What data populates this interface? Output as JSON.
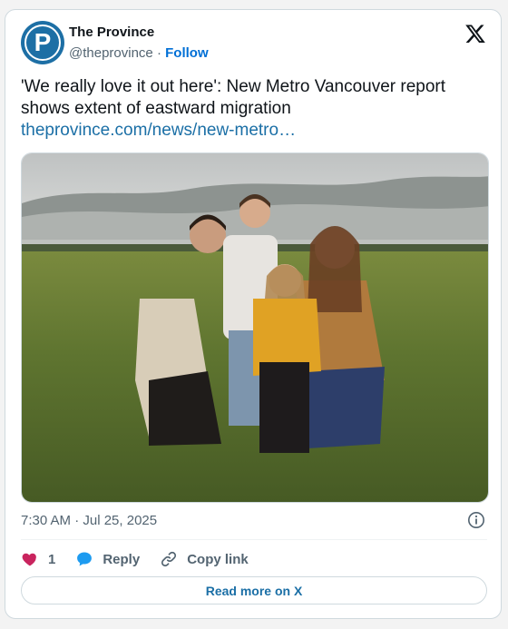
{
  "account": {
    "avatar_letter": "P",
    "name": "The Province",
    "handle": "@theprovince",
    "separator": "·",
    "follow_label": "Follow"
  },
  "tweet": {
    "text": "'We really love it out here': New Metro Vancouver report shows extent of eastward migration",
    "link": "theprovince.com/news/new-metro…"
  },
  "photo": {
    "icon": "family-photo"
  },
  "meta": {
    "timestamp": "7:30 AM · Jul 25, 2025"
  },
  "actions": {
    "like_count": "1",
    "reply_label": "Reply",
    "copy_label": "Copy link"
  },
  "read_more_label": "Read more on X",
  "colors": {
    "brand_blue": "#1d6fa5",
    "link_blue": "#1b6fa6",
    "heart": "#c9245e",
    "reply": "#1d9bf0"
  }
}
